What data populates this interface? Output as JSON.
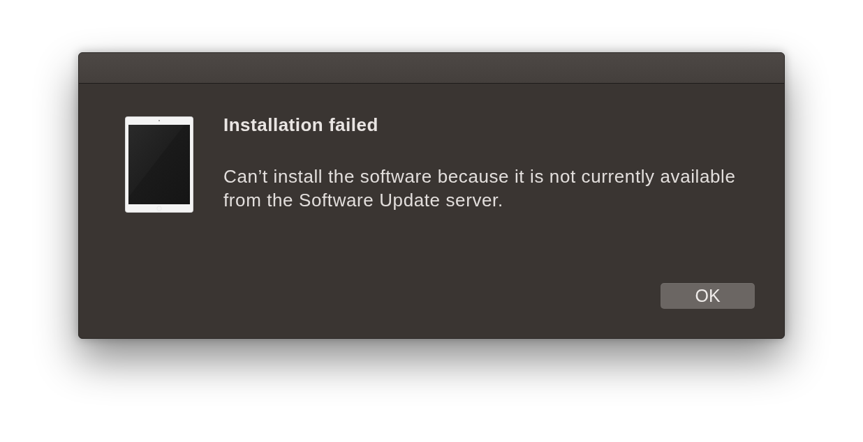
{
  "dialog": {
    "title": "Installation failed",
    "message": "Can’t install the software because it is not currently available from the Software Update server.",
    "buttons": [
      {
        "label": "OK"
      }
    ]
  }
}
